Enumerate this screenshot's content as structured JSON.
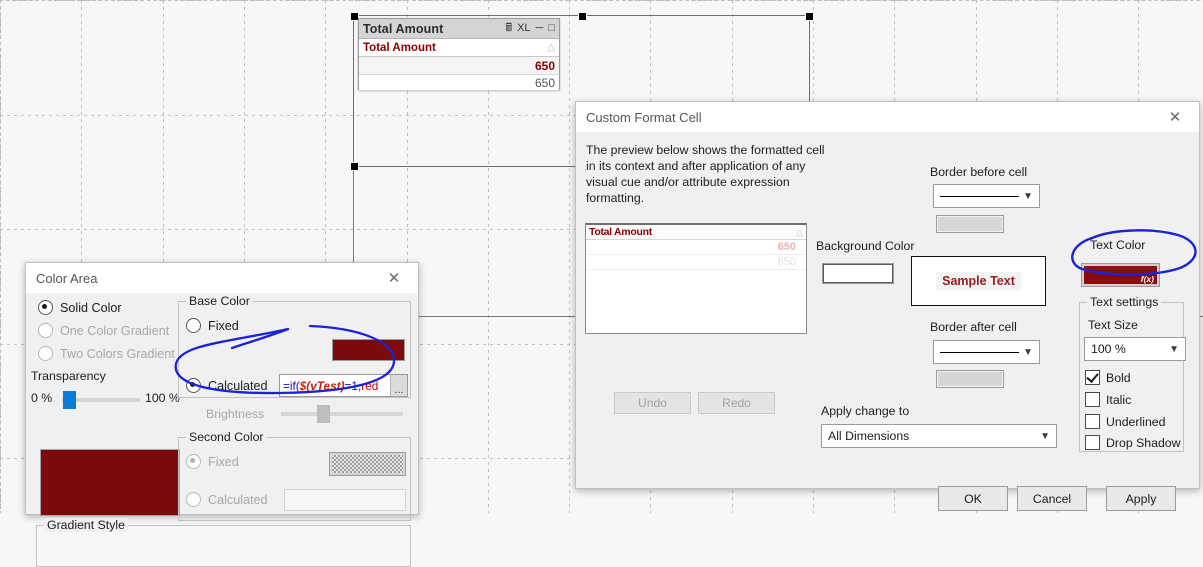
{
  "canvas": {
    "chart_object": {
      "caption_title": "Total Amount",
      "caption_icons": [
        "print-icon",
        "export-xl-icon",
        "minimize-icon",
        "maximize-icon"
      ],
      "xl_label": "XL",
      "column_header": "Total Amount",
      "rows": [
        {
          "value": "650",
          "emphasis": "bold-red"
        },
        {
          "value": "650",
          "emphasis": "normal"
        }
      ]
    }
  },
  "color_area_dialog": {
    "title": "Color Area",
    "close_label": "✕",
    "fill_modes": [
      {
        "label": "Solid Color",
        "selected": true,
        "enabled": true
      },
      {
        "label": "One Color Gradient",
        "selected": false,
        "enabled": false
      },
      {
        "label": "Two Colors Gradient",
        "selected": false,
        "enabled": false
      }
    ],
    "transparency": {
      "label": "Transparency",
      "min_label": "0 %",
      "max_label": "100 %",
      "value_pct": 12
    },
    "preview_color": "#7d0a0a",
    "base_color": {
      "group_label": "Base Color",
      "fixed_label": "Fixed",
      "fixed_selected": false,
      "calculated_label": "Calculated",
      "calculated_selected": true,
      "swatch_color": "#7d0a0a",
      "expression_parts": [
        {
          "text": "=if(",
          "style": "kw"
        },
        {
          "text": "$(vTest)",
          "style": "var"
        },
        {
          "text": "=1,",
          "style": "kw"
        },
        {
          "text": "red",
          "style": "col"
        }
      ],
      "expression_full": "=if($(vTest)=1,red",
      "ellipsis_button": "...",
      "brightness_label": "Brightness",
      "brightness_enabled": false
    },
    "second_color": {
      "group_label": "Second Color",
      "fixed_label": "Fixed",
      "fixed_selected": true,
      "calculated_label": "Calculated",
      "calculated_selected": false,
      "swatch": "transparent-checker",
      "expression": ""
    },
    "gradient_style": {
      "group_label": "Gradient Style"
    }
  },
  "custom_format_cell_dialog": {
    "title": "Custom Format Cell",
    "close_label": "✕",
    "description": "The preview below shows the formatted cell in its context and after application of any visual cue and/or attribute expression formatting.",
    "preview": {
      "header": "Total Amount",
      "sort_icon": "sort-arrow-icon",
      "rows": [
        {
          "value": "650",
          "style": "faded-bold-red"
        },
        {
          "value": "650",
          "style": "faded-grey"
        }
      ]
    },
    "undo_label": "Undo",
    "redo_label": "Redo",
    "background_color_label": "Background Color",
    "background_color_value": "#ffffff",
    "sample_text": "Sample Text",
    "sample_text_color": "#9b1c20",
    "border_before_cell_label": "Border before cell",
    "border_before_cell_value": "solid-line",
    "border_after_cell_label": "Border after cell",
    "border_after_cell_value": "solid-line",
    "apply_change_to_label": "Apply change to",
    "apply_change_to_value": "All Dimensions",
    "text_color_label": "Text Color",
    "text_color_value": "#8f0f0f",
    "text_color_is_expression": true,
    "text_color_fx_badge": "f(x)",
    "text_settings": {
      "group_label": "Text settings",
      "text_size_label": "Text Size",
      "text_size_value": "100 %",
      "checkboxes": [
        {
          "label": "Bold",
          "checked": true
        },
        {
          "label": "Italic",
          "checked": false
        },
        {
          "label": "Underlined",
          "checked": false
        },
        {
          "label": "Drop Shadow",
          "checked": false
        }
      ]
    },
    "buttons": {
      "ok": "OK",
      "cancel": "Cancel",
      "apply": "Apply"
    }
  },
  "annotations": {
    "ink_color": "#1b22d8",
    "ellipse_1_target": "calculated-expression-row",
    "ellipse_2_target": "text-color-swatch"
  }
}
